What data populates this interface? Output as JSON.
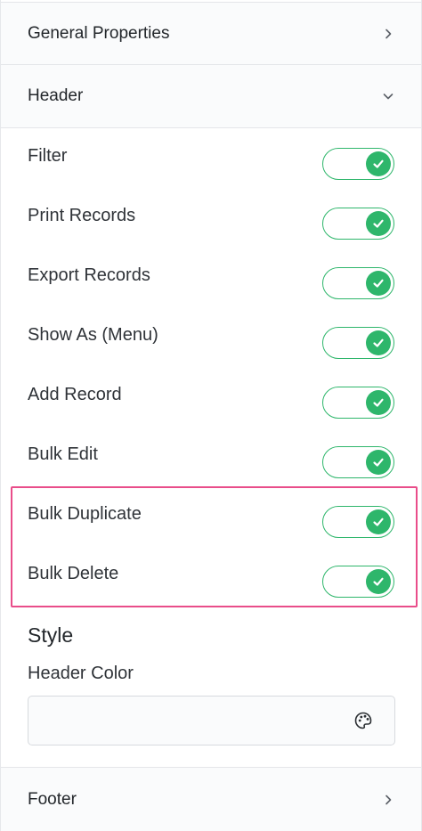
{
  "sections": {
    "general": {
      "title": "General Properties"
    },
    "header": {
      "title": "Header"
    },
    "footer": {
      "title": "Footer"
    }
  },
  "toggles": [
    {
      "label": "Filter",
      "on": true
    },
    {
      "label": "Print Records",
      "on": true
    },
    {
      "label": "Export Records",
      "on": true
    },
    {
      "label": "Show As (Menu)",
      "on": true
    },
    {
      "label": "Add Record",
      "on": true
    },
    {
      "label": "Bulk Edit",
      "on": true
    },
    {
      "label": "Bulk Duplicate",
      "on": true
    },
    {
      "label": "Bulk Delete",
      "on": true
    }
  ],
  "style": {
    "title": "Style",
    "header_color_label": "Header Color",
    "header_color_value": ""
  },
  "icons": {
    "collapsed": "chevron-right-icon",
    "expanded": "chevron-down-icon",
    "toggle_on": "check-icon",
    "color_picker": "palette-icon"
  },
  "colors": {
    "toggle_on": "#2eb66b",
    "highlight": "#e94d8a"
  }
}
